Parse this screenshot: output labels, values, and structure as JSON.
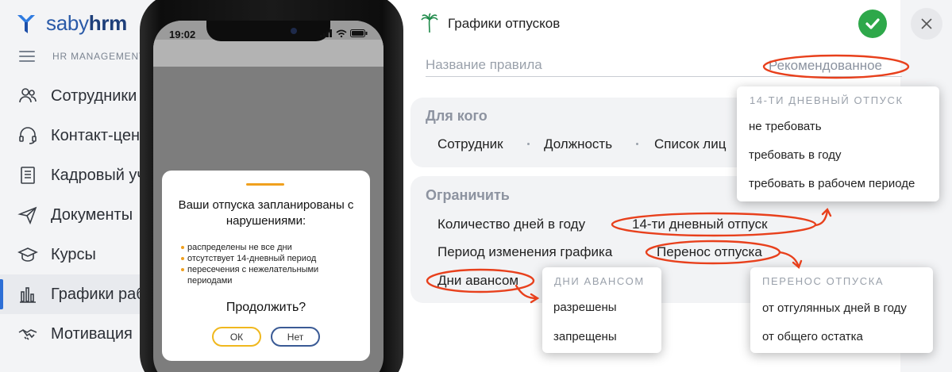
{
  "app": {
    "logo_name": "saby",
    "logo_suffix": "hrm",
    "menu_caption": "HR MANAGEMENT"
  },
  "sidebar": {
    "items": [
      {
        "label": "Сотрудники",
        "icon": "people-icon"
      },
      {
        "label": "Контакт-центр",
        "icon": "headset-icon"
      },
      {
        "label": "Кадровый учет",
        "icon": "document-list-icon"
      },
      {
        "label": "Документы",
        "icon": "paper-plane-icon"
      },
      {
        "label": "Курсы",
        "icon": "graduation-cap-icon"
      },
      {
        "label": "Графики работы",
        "icon": "bar-chart-icon",
        "active": true
      },
      {
        "label": "Мотивация",
        "icon": "handshake-icon"
      }
    ]
  },
  "phone": {
    "time": "19:02",
    "dialog": {
      "title": "Ваши отпуска запланированы с нарушениями:",
      "items": [
        "распределены не все дни",
        "отсутствует 14-дневный период",
        "пересечения с нежелательными периодами"
      ],
      "question": "Продолжить?",
      "ok_label": "ОК",
      "no_label": "Нет"
    },
    "accent_color": "#f0a01e"
  },
  "panel": {
    "title": "Графики отпусков",
    "rule_placeholder": "Название правила",
    "rule_value": "Рекомендованное",
    "for_whom": {
      "title": "Для кого",
      "options": [
        "Сотрудник",
        "Должность",
        "Список лиц"
      ]
    },
    "limit": {
      "title": "Ограничить",
      "rows": [
        {
          "label": "Количество дней в году",
          "value": "14-ти дневный отпуск"
        },
        {
          "label": "Период изменения графика",
          "value": "Перенос отпуска"
        }
      ],
      "advance_label": "Дни авансом"
    }
  },
  "popups": {
    "vacation14": {
      "header": "14-ТИ ДНЕВНЫЙ ОТПУСК",
      "items": [
        "не требовать",
        "требовать в году",
        "требовать в рабочем периоде"
      ]
    },
    "advance": {
      "header": "ДНИ АВАНСОМ",
      "items": [
        "разрешены",
        "запрещены"
      ]
    },
    "transfer": {
      "header": "ПЕРЕНОС ОТПУСКА",
      "items": [
        "от отгулянных дней в году",
        "от общего остатка"
      ]
    }
  },
  "colors": {
    "brand": "#2a5aa8",
    "accept": "#2ea84a",
    "annotation": "#e8401c"
  }
}
